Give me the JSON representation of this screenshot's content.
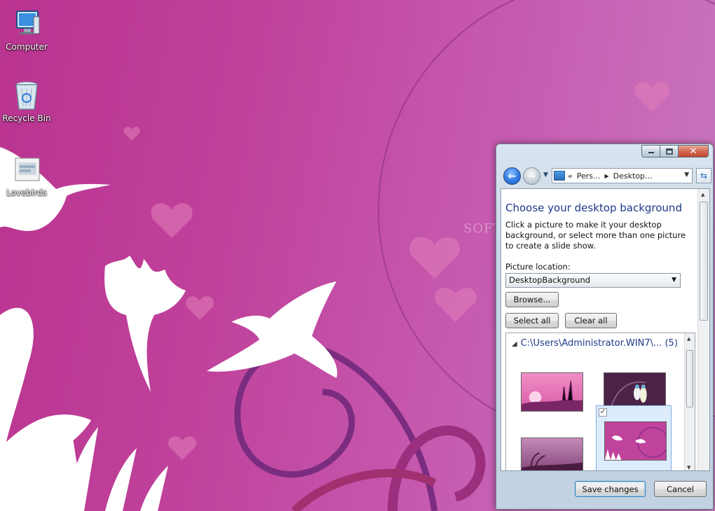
{
  "desktop": {
    "icons": [
      {
        "label": "Computer"
      },
      {
        "label": "Recycle Bin"
      },
      {
        "label": "Lovebirds"
      }
    ],
    "watermark": "SOFT"
  },
  "window": {
    "address": {
      "chevrons": "«",
      "part1": "Pers...",
      "part2": "Desktop..."
    },
    "heading": "Choose your desktop background",
    "description": "Click a picture to make it your desktop background, or select more than one picture to create a slide show.",
    "picture_location_label": "Picture location:",
    "picture_location_value": "DesktopBackground",
    "browse_label": "Browse...",
    "select_all_label": "Select all",
    "clear_all_label": "Clear all",
    "folder": {
      "path": "C:\\Users\\Administrator.WIN7\\...",
      "count": "(5)"
    },
    "thumbnails": [
      {
        "selected": false,
        "checked": false
      },
      {
        "selected": false,
        "checked": false
      },
      {
        "selected": false,
        "checked": false
      },
      {
        "selected": true,
        "checked": true,
        "check_glyph": "✓"
      }
    ],
    "save_label": "Save changes",
    "cancel_label": "Cancel"
  },
  "colors": {
    "accent_heading": "#1e3a8a",
    "desktop_pink": "#c0439c",
    "selection": "#dcecfc"
  }
}
